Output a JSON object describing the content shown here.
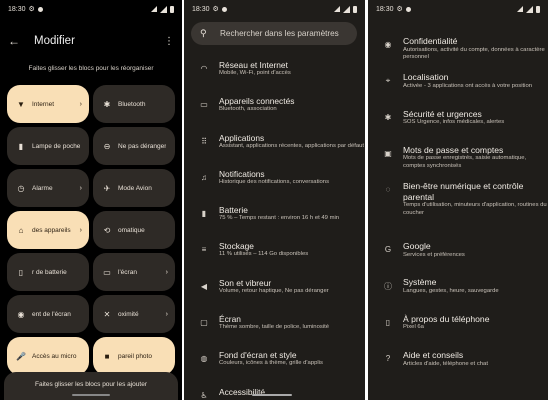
{
  "status": {
    "time": "18:30"
  },
  "panel1": {
    "title": "Modifier",
    "hint_top": "Faites glisser les blocs pour les réorganiser",
    "tiles": [
      {
        "label": "Internet",
        "icon": "wifi-icon",
        "glyph": "▼",
        "state": "on",
        "chevron": "›"
      },
      {
        "label": "Bluetooth",
        "icon": "bluetooth-icon",
        "glyph": "✱",
        "state": "off",
        "chevron": ""
      },
      {
        "label": "Lampe de poche",
        "icon": "flashlight-icon",
        "glyph": "▮",
        "state": "off",
        "chevron": ""
      },
      {
        "label": "Ne pas déranger",
        "icon": "dnd-icon",
        "glyph": "⊖",
        "state": "off",
        "chevron": ""
      },
      {
        "label": "Alarme",
        "icon": "alarm-icon",
        "glyph": "◷",
        "state": "off",
        "chevron": "›"
      },
      {
        "label": "Mode Avion",
        "icon": "airplane-icon",
        "glyph": "✈",
        "state": "off",
        "chevron": ""
      },
      {
        "label": "des appareils",
        "icon": "home-icon",
        "glyph": "⌂",
        "state": "on",
        "chevron": "›"
      },
      {
        "label": "omatique",
        "icon": "rotate-icon",
        "glyph": "⟲",
        "state": "off",
        "chevron": ""
      },
      {
        "label": "r de batterie",
        "icon": "battery-saver-icon",
        "glyph": "▯",
        "state": "off",
        "chevron": ""
      },
      {
        "label": "l'écran",
        "icon": "cast-icon",
        "glyph": "▭",
        "state": "off",
        "chevron": "›"
      },
      {
        "label": "ent de l'écran",
        "icon": "screen-record-icon",
        "glyph": "◉",
        "state": "off",
        "chevron": ""
      },
      {
        "label": "oximité",
        "icon": "nearby-share-icon",
        "glyph": "✕",
        "state": "off",
        "chevron": "›"
      },
      {
        "label": "Accès au micro",
        "icon": "mic-icon",
        "glyph": "🎤",
        "state": "on",
        "chevron": ""
      },
      {
        "label": "pareil photo",
        "icon": "camera-icon",
        "glyph": "■",
        "state": "on",
        "chevron": ""
      }
    ],
    "hint_bottom": "Faites glisser les blocs pour les ajouter"
  },
  "panel2": {
    "search_placeholder": "Rechercher dans les paramètres",
    "items": [
      {
        "title": "Réseau et Internet",
        "sub": "Mobile, Wi-Fi, point d'accès",
        "icon": "wifi-icon",
        "glyph": "◠"
      },
      {
        "title": "Appareils connectés",
        "sub": "Bluetooth, association",
        "icon": "devices-icon",
        "glyph": "▭"
      },
      {
        "title": "Applications",
        "sub": "Assistant, applications récentes, applications par défaut",
        "icon": "apps-icon",
        "glyph": "⠿"
      },
      {
        "title": "Notifications",
        "sub": "Historique des notifications, conversations",
        "icon": "bell-icon",
        "glyph": "♫"
      },
      {
        "title": "Batterie",
        "sub": "75 % – Temps restant : environ 16 h et 49 min",
        "icon": "battery-icon",
        "glyph": "▮"
      },
      {
        "title": "Stockage",
        "sub": "11 % utilisés – 114 Go disponibles",
        "icon": "storage-icon",
        "glyph": "≡"
      },
      {
        "title": "Son et vibreur",
        "sub": "Volume, retour haptique, Ne pas déranger",
        "icon": "volume-icon",
        "glyph": "◀"
      },
      {
        "title": "Écran",
        "sub": "Thème sombre, taille de police, luminosité",
        "icon": "display-icon",
        "glyph": "▢"
      },
      {
        "title": "Fond d'écran et style",
        "sub": "Couleurs, icônes à thème, grille d'applis",
        "icon": "palette-icon",
        "glyph": "◍"
      },
      {
        "title": "Accessibilité",
        "sub": "",
        "icon": "accessibility-icon",
        "glyph": "♿"
      }
    ]
  },
  "panel3": {
    "items": [
      {
        "title": "Confidentialité",
        "sub": "Autorisations, activité du compte, données à caractère personnel",
        "icon": "privacy-icon",
        "glyph": "◉"
      },
      {
        "title": "Localisation",
        "sub": "Activée - 3 applications ont accès à votre position",
        "icon": "location-icon",
        "glyph": "⌖"
      },
      {
        "title": "Sécurité et urgences",
        "sub": "SOS Urgence, infos médicales, alertes",
        "icon": "emergency-icon",
        "glyph": "✱"
      },
      {
        "title": "Mots de passe et comptes",
        "sub": "Mots de passe enregistrés, saisie automatique, comptes synchronisés",
        "icon": "account-icon",
        "glyph": "▣"
      },
      {
        "title": "Bien-être numérique et contrôle parental",
        "sub": "Temps d'utilisation, minuteurs d'application, routines du coucher",
        "icon": "wellbeing-icon",
        "glyph": "◌",
        "tall": true
      },
      {
        "title": "Google",
        "sub": "Services et préférences",
        "icon": "google-icon",
        "glyph": "G"
      },
      {
        "title": "Système",
        "sub": "Langues, gestes, heure, sauvegarde",
        "icon": "info-icon",
        "glyph": "ⓘ"
      },
      {
        "title": "À propos du téléphone",
        "sub": "Pixel 6a",
        "icon": "phone-icon",
        "glyph": "▯"
      },
      {
        "title": "Aide et conseils",
        "sub": "Articles d'aide, téléphone et chat",
        "icon": "help-icon",
        "glyph": "?"
      }
    ]
  }
}
